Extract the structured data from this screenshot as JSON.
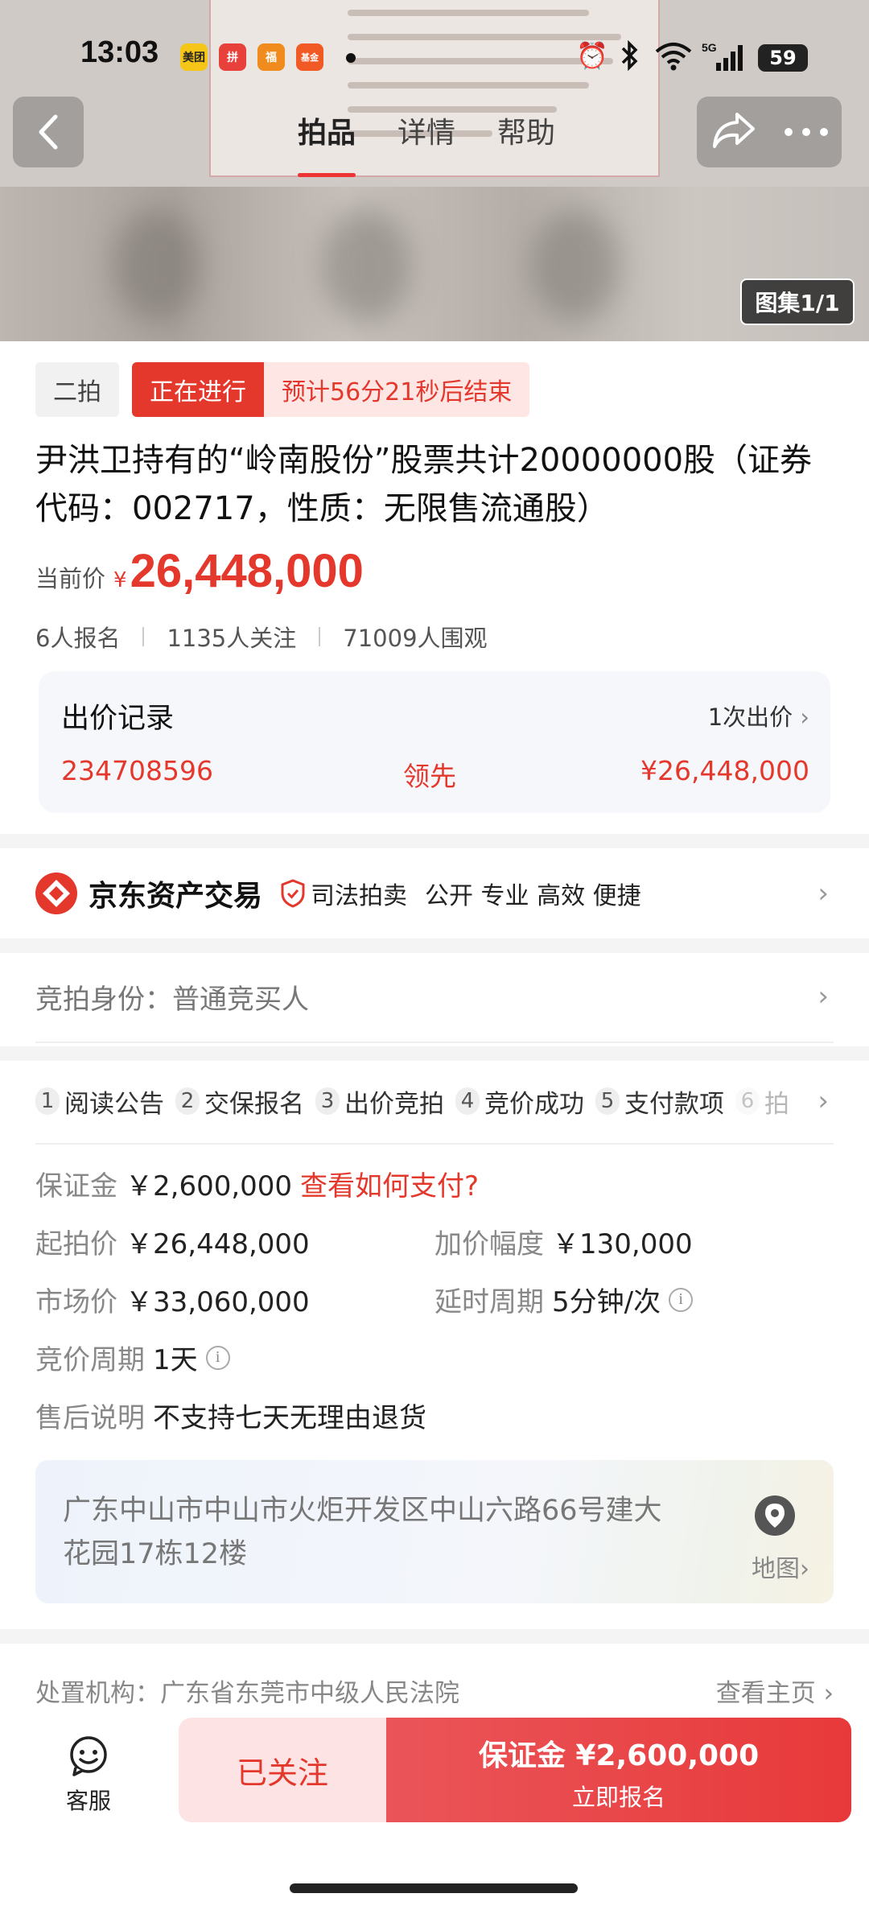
{
  "status_bar": {
    "time": "13:03",
    "apps": [
      "美团",
      "拼",
      "福",
      "基金"
    ],
    "network": "5G",
    "battery": "59"
  },
  "nav": {
    "tabs": [
      "拍品",
      "详情",
      "帮助"
    ],
    "active_tab": 0,
    "gallery": "图集1/1"
  },
  "auction": {
    "round": "二拍",
    "status": "正在进行",
    "countdown": "预计56分21秒后结束",
    "title": "尹洪卫持有的“岭南股份”股票共计20000000股（证券代码：002717，性质：无限售流通股）",
    "price_label": "当前价",
    "currency": "¥",
    "current_price": "26,448,000",
    "stats": [
      "6人报名",
      "1135人关注",
      "71009人围观"
    ]
  },
  "bid_record": {
    "title": "出价记录",
    "count": "1次出价",
    "bidder": "234708596",
    "status": "领先",
    "price": "¥26,448,000"
  },
  "brand": {
    "name": "京东资产交易",
    "sub": "司法拍卖",
    "slogan": "公开 专业 高效 便捷"
  },
  "identity": {
    "label": "竞拍身份：",
    "value": "普通竞买人"
  },
  "steps": [
    {
      "num": "1",
      "label": "阅读公告"
    },
    {
      "num": "2",
      "label": "交保报名"
    },
    {
      "num": "3",
      "label": "出价竞拍"
    },
    {
      "num": "4",
      "label": "竞价成功"
    },
    {
      "num": "5",
      "label": "支付款项"
    },
    {
      "num": "6",
      "label": "拍"
    }
  ],
  "details": {
    "deposit_label": "保证金",
    "deposit": "￥2,600,000",
    "deposit_link": "查看如何支付?",
    "start_price_label": "起拍价",
    "start_price": "￥26,448,000",
    "increment_label": "加价幅度",
    "increment": "￥130,000",
    "market_price_label": "市场价",
    "market_price": "￥33,060,000",
    "delay_label": "延时周期",
    "delay": "5分钟/次",
    "cycle_label": "竞价周期",
    "cycle": "1天",
    "aftersale_label": "售后说明",
    "aftersale": "不支持七天无理由退货"
  },
  "address": {
    "text": "广东中山市中山市火炬开发区中山六路66号建大花园17栋12楼",
    "map_label": "地图›"
  },
  "agency": {
    "label": "处置机构：",
    "name": "广东省东莞市中级人民法院",
    "home_link": "查看主页 ›"
  },
  "bottom": {
    "service": "客服",
    "follow": "已关注",
    "deposit_btn": "保证金 ¥2,600,000",
    "signup": "立即报名"
  },
  "colors": {
    "accent": "#e4382d",
    "accent_light": "#fde6e4"
  }
}
